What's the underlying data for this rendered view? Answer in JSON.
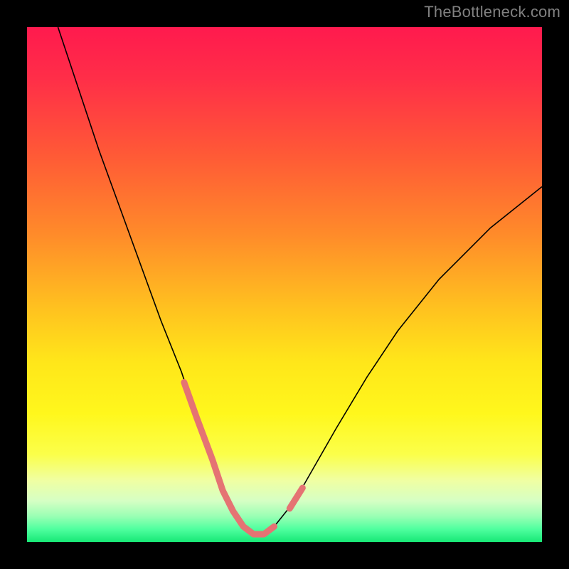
{
  "watermark": "TheBottleneck.com",
  "gradient_stops": [
    {
      "offset": 0.0,
      "color": "#ff1a4e"
    },
    {
      "offset": 0.1,
      "color": "#ff2e48"
    },
    {
      "offset": 0.25,
      "color": "#ff5a36"
    },
    {
      "offset": 0.4,
      "color": "#ff8a2a"
    },
    {
      "offset": 0.55,
      "color": "#ffc31f"
    },
    {
      "offset": 0.65,
      "color": "#ffe61a"
    },
    {
      "offset": 0.75,
      "color": "#fff71c"
    },
    {
      "offset": 0.83,
      "color": "#fbff4a"
    },
    {
      "offset": 0.88,
      "color": "#f0ffa2"
    },
    {
      "offset": 0.92,
      "color": "#d6ffc4"
    },
    {
      "offset": 0.95,
      "color": "#9affb4"
    },
    {
      "offset": 0.975,
      "color": "#4fff9f"
    },
    {
      "offset": 1.0,
      "color": "#17e876"
    }
  ],
  "chart_data": {
    "type": "line",
    "title": "",
    "xlabel": "",
    "ylabel": "",
    "xlim": [
      0,
      100
    ],
    "ylim": [
      0,
      100
    ],
    "grid": false,
    "series": [
      {
        "name": "bottleneck-curve",
        "color": "#000000",
        "width": 1.6,
        "x": [
          6,
          10,
          14,
          18,
          22,
          26,
          30,
          33,
          36,
          38,
          40,
          42,
          44,
          46,
          48,
          52,
          56,
          60,
          66,
          72,
          80,
          90,
          100
        ],
        "y": [
          100,
          88,
          76,
          65,
          54,
          43,
          33,
          24,
          16,
          10,
          6,
          3,
          1.5,
          1.5,
          3,
          8,
          15,
          22,
          32,
          41,
          51,
          61,
          69
        ]
      },
      {
        "name": "highlight-band",
        "color": "#e57373",
        "width": 9,
        "linecap": "round",
        "segments": [
          {
            "x": [
              30.5,
              33,
              36,
              38,
              40,
              42,
              44,
              46,
              48
            ],
            "y": [
              31,
              24,
              16,
              10,
              6,
              3,
              1.5,
              1.5,
              3
            ]
          },
          {
            "x": [
              51,
              53.5
            ],
            "y": [
              6.5,
              10.5
            ]
          }
        ]
      }
    ]
  }
}
